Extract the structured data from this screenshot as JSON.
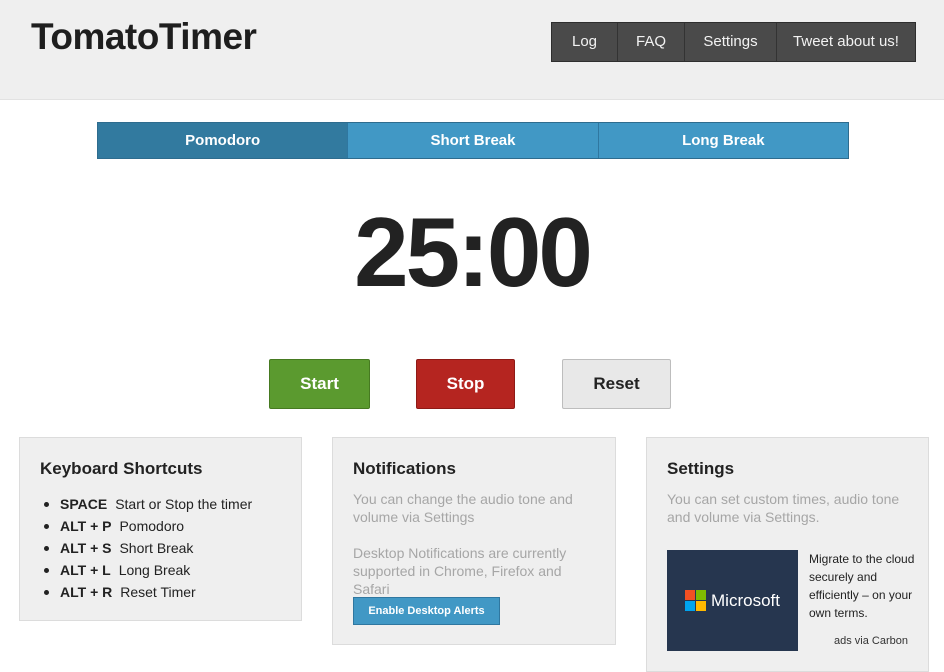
{
  "app": {
    "logo": "TomatoTimer"
  },
  "nav": {
    "items": [
      "Log",
      "FAQ",
      "Settings",
      "Tweet about us!"
    ]
  },
  "tabs": [
    {
      "label": "Pomodoro",
      "active": true
    },
    {
      "label": "Short Break",
      "active": false
    },
    {
      "label": "Long Break",
      "active": false
    }
  ],
  "timer": {
    "display": "25:00"
  },
  "controls": {
    "start_label": "Start",
    "stop_label": "Stop",
    "reset_label": "Reset"
  },
  "shortcuts": {
    "title": "Keyboard Shortcuts",
    "items": [
      {
        "key": "SPACE",
        "action": "Start or Stop the timer"
      },
      {
        "key": "ALT + P",
        "action": "Pomodoro"
      },
      {
        "key": "ALT + S",
        "action": "Short Break"
      },
      {
        "key": "ALT + L",
        "action": "Long Break"
      },
      {
        "key": "ALT + R",
        "action": "Reset Timer"
      }
    ]
  },
  "notifications": {
    "title": "Notifications",
    "text1": "You can change the audio tone and volume via Settings",
    "text2": "Desktop Notifications are currently supported in Chrome, Firefox and Safari",
    "button_label": "Enable Desktop Alerts"
  },
  "settings": {
    "title": "Settings",
    "text": "You can set custom times, audio tone and volume via Settings."
  },
  "ad": {
    "brand": "Microsoft",
    "text": "Migrate to the cloud securely and efficiently – on your own terms.",
    "via": "ads via Carbon"
  },
  "colors": {
    "tab_active": "#327a9f",
    "tab": "#4198c5",
    "start": "#5b9a2f",
    "stop": "#b52520",
    "ms_red": "#f25022",
    "ms_green": "#7fba00",
    "ms_blue": "#00a4ef",
    "ms_yellow": "#ffb900"
  }
}
